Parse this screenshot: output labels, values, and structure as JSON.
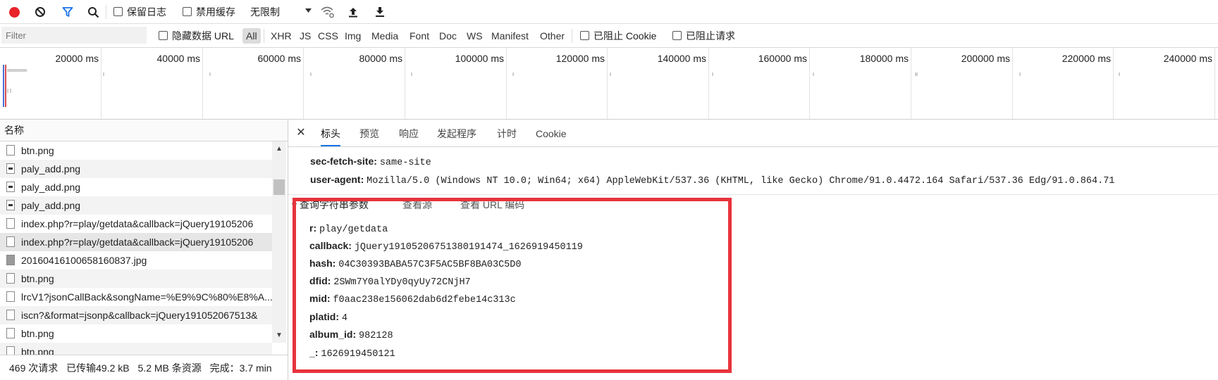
{
  "toolbar": {
    "preserve_log_label": "保留日志",
    "disable_cache_label": "禁用缓存",
    "throttle_value": "无限制",
    "throttle_options": [
      "无限制"
    ]
  },
  "filterbar": {
    "filter_placeholder": "Filter",
    "hide_data_url_label": "隐藏数据 URL",
    "types": [
      "All",
      "XHR",
      "JS",
      "CSS",
      "Img",
      "Media",
      "Font",
      "Doc",
      "WS",
      "Manifest",
      "Other"
    ],
    "blocked_cookies_label": "已阻止 Cookie",
    "blocked_requests_label": "已阻止请求"
  },
  "timeline": {
    "ticks": [
      "20000 ms",
      "40000 ms",
      "60000 ms",
      "80000 ms",
      "100000 ms",
      "120000 ms",
      "140000 ms",
      "160000 ms",
      "180000 ms",
      "200000 ms",
      "220000 ms",
      "240000 ms"
    ]
  },
  "request_list": {
    "header": "名称",
    "rows": [
      {
        "name": "btn.png",
        "icon": "file-icon"
      },
      {
        "name": "paly_add.png",
        "icon": "image-icon"
      },
      {
        "name": "paly_add.png",
        "icon": "image-icon"
      },
      {
        "name": "paly_add.png",
        "icon": "image-icon"
      },
      {
        "name": "index.php?r=play/getdata&callback=jQuery19105206",
        "icon": "file-icon"
      },
      {
        "name": "index.php?r=play/getdata&callback=jQuery19105206",
        "icon": "file-icon"
      },
      {
        "name": "20160416100658160837.jpg",
        "icon": "photo-icon"
      },
      {
        "name": "btn.png",
        "icon": "file-icon"
      },
      {
        "name": "lrcV1?jsonCallBack&songName=%E9%9C%80%E8%A...",
        "icon": "file-icon"
      },
      {
        "name": "iscn?&format=jsonp&callback=jQuery191052067513&",
        "icon": "file-icon"
      },
      {
        "name": "btn.png",
        "icon": "file-icon"
      },
      {
        "name": "btn.png",
        "icon": "file-icon"
      }
    ],
    "status": {
      "requests": "469 次请求",
      "transferred": "已传输49.2 kB",
      "resources": "5.2 MB 条资源",
      "finish": "完成：3.7 min"
    }
  },
  "details": {
    "tabs": [
      "标头",
      "预览",
      "响应",
      "发起程序",
      "计时",
      "Cookie"
    ],
    "active_tab": "标头",
    "headers": [
      {
        "key": "sec-fetch-site:",
        "value": "same-site"
      },
      {
        "key": "user-agent:",
        "value": "Mozilla/5.0 (Windows NT 10.0; Win64; x64) AppleWebKit/537.36 (KHTML, like Gecko) Chrome/91.0.4472.164 Safari/537.36 Edg/91.0.864.71"
      }
    ],
    "query_section": {
      "title": "▾ 查询字符串参数",
      "view_source": "查看源",
      "view_url_encoded": "查看 URL 编码",
      "params": [
        {
          "key": "r:",
          "value": "play/getdata"
        },
        {
          "key": "callback:",
          "value": "jQuery19105206751380191474_1626919450119"
        },
        {
          "key": "hash:",
          "value": "04C30393BABA57C3F5AC5BF8BA03C5D0"
        },
        {
          "key": "dfid:",
          "value": "2SWm7Y0alYDy0qyUy72CNjH7"
        },
        {
          "key": "mid:",
          "value": "f0aac238e156062dab6d2febe14c313c"
        },
        {
          "key": "platid:",
          "value": "4"
        },
        {
          "key": "album_id:",
          "value": "982128"
        },
        {
          "key": "_:",
          "value": "1626919450121"
        }
      ]
    }
  },
  "colors": {
    "record": "#e8232a",
    "filter_active": "#1a73e8",
    "highlight_box": "#e8333c"
  }
}
